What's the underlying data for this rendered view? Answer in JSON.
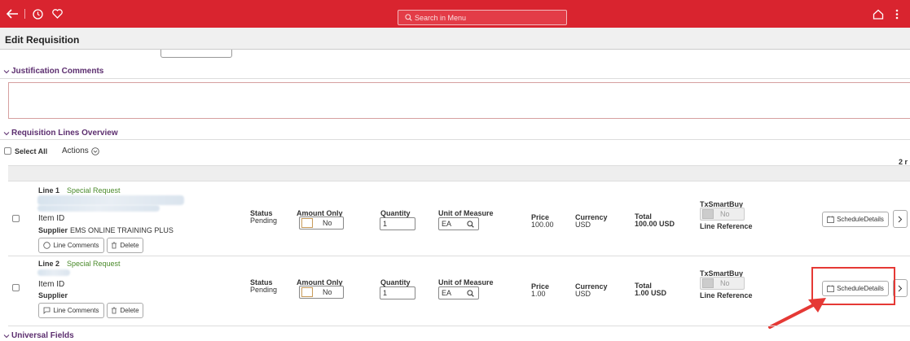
{
  "header": {
    "search_placeholder": "Search in Menu",
    "icons": [
      "back-arrow-icon",
      "history-icon",
      "favorite-heart-icon",
      "home-icon",
      "more-vertical-icon"
    ]
  },
  "page": {
    "title": "Edit Requisition"
  },
  "sections": {
    "justification": "Justification Comments",
    "lines_overview": "Requisition Lines Overview",
    "universal": "Universal Fields"
  },
  "toolbar": {
    "select_all": "Select All",
    "actions": "Actions",
    "row_count": "2 r"
  },
  "labels": {
    "item_id": "Item ID",
    "supplier": "Supplier",
    "status": "Status",
    "amount_only": "Amount Only",
    "quantity": "Quantity",
    "unit_of_measure": "Unit of Measure",
    "price": "Price",
    "currency": "Currency",
    "total": "Total",
    "txsmartbuy": "TxSmartBuy",
    "line_reference": "Line Reference",
    "line_comments": "Line Comments",
    "delete": "Delete",
    "schedule_details": "ScheduleDetails"
  },
  "lines": [
    {
      "line": "Line 1",
      "type": "Special Request",
      "supplier_name": "EMS ONLINE TRAINING PLUS",
      "status": "Pending",
      "amount_only": "No",
      "quantity": "1",
      "uom": "EA",
      "price": "100.00",
      "currency": "USD",
      "total": "100.00 USD",
      "txsmartbuy": "No"
    },
    {
      "line": "Line 2",
      "type": "Special Request",
      "supplier_name": "",
      "status": "Pending",
      "amount_only": "No",
      "quantity": "1",
      "uom": "EA",
      "price": "1.00",
      "currency": "USD",
      "total": "1.00 USD",
      "txsmartbuy": "No"
    }
  ],
  "colors": {
    "header": "#d9242f",
    "section": "#5c2e6f",
    "accent_green": "#4a8a2a",
    "callout": "#e53935"
  }
}
